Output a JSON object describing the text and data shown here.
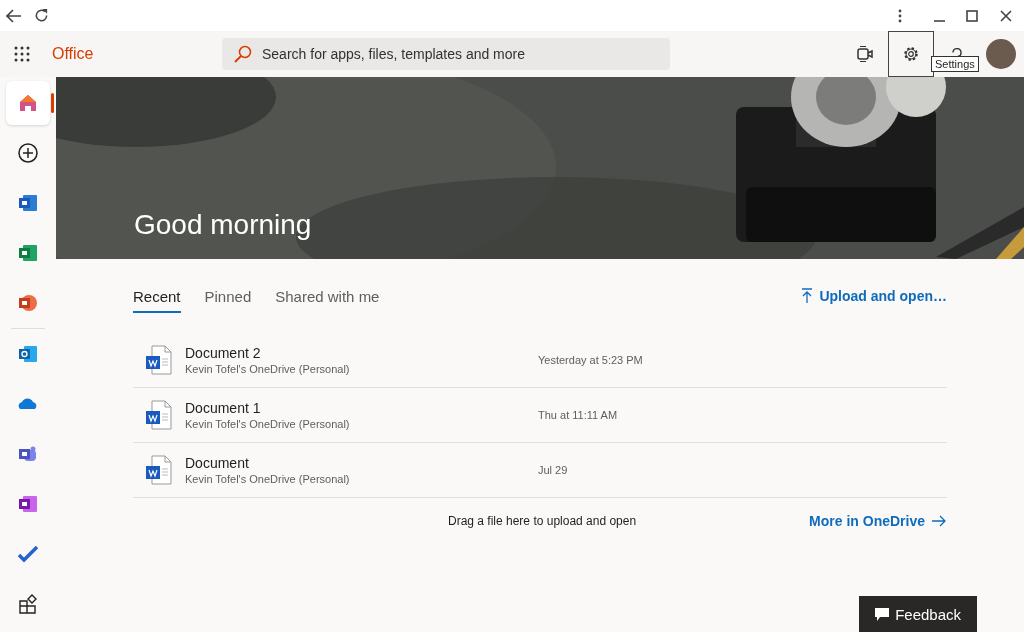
{
  "header": {
    "brand": "Office",
    "search": {
      "placeholder": "Search for apps, files, templates and more"
    },
    "tooltip": "Settings"
  },
  "sidebar": {
    "items": [
      {
        "selected": true
      },
      {
        "selected": false
      },
      {
        "selected": false
      },
      {
        "selected": false
      },
      {
        "selected": false
      },
      {
        "selected": false
      },
      {
        "selected": false
      },
      {
        "selected": false
      },
      {
        "selected": false
      },
      {
        "selected": false
      },
      {
        "selected": false
      }
    ]
  },
  "hero": {
    "greeting": "Good morning"
  },
  "tabs": [
    {
      "label": "Recent",
      "selected": true
    },
    {
      "label": "Pinned",
      "selected": false
    },
    {
      "label": "Shared with me",
      "selected": false
    }
  ],
  "upload_link": "Upload and open…",
  "files": [
    {
      "name": "Document 2",
      "location": "Kevin Tofel's OneDrive (Personal)",
      "modified": "Yesterday at 5:23 PM"
    },
    {
      "name": "Document 1",
      "location": "Kevin Tofel's OneDrive (Personal)",
      "modified": "Thu at 11:11 AM"
    },
    {
      "name": "Document",
      "location": "Kevin Tofel's OneDrive (Personal)",
      "modified": "Jul 29"
    }
  ],
  "drop_hint": "Drag a file here to upload and open",
  "more_link": "More in OneDrive",
  "feedback_button": "Feedback"
}
